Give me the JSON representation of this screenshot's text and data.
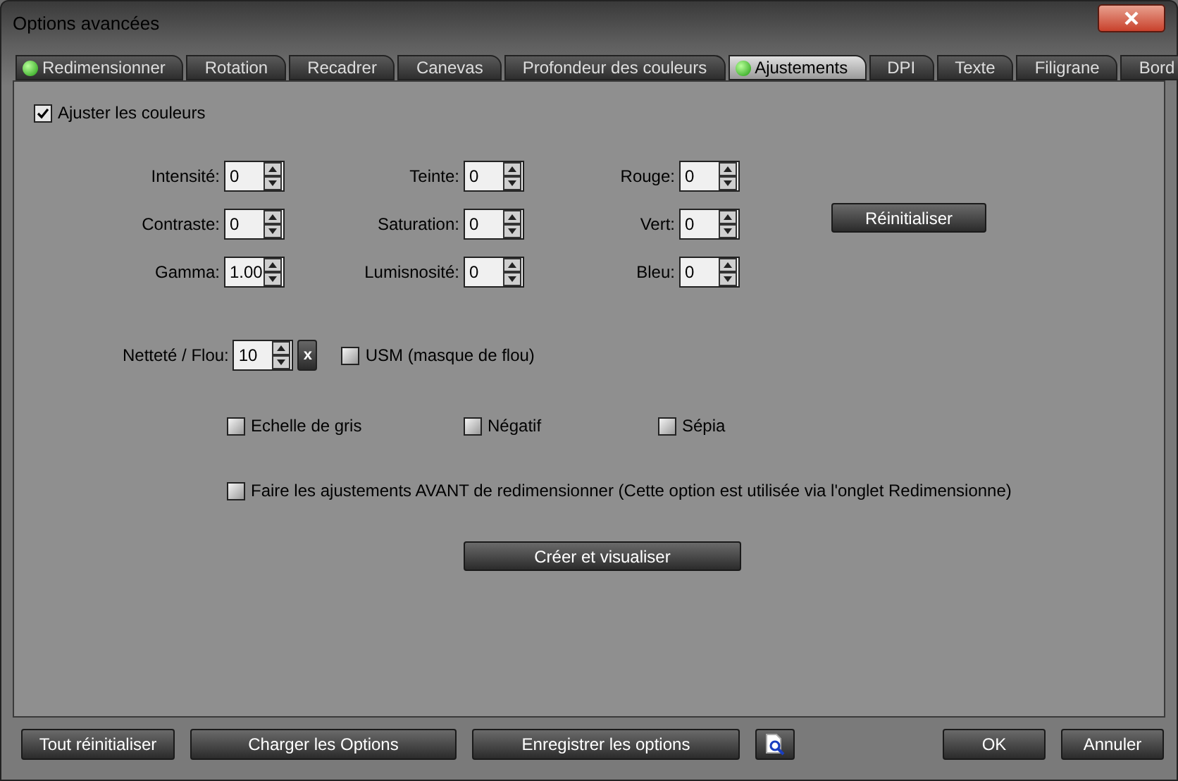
{
  "window": {
    "title": "Options avancées"
  },
  "tabs": [
    {
      "label": "Redimensionner",
      "selected": false,
      "indicator": true
    },
    {
      "label": "Rotation",
      "selected": false,
      "indicator": false
    },
    {
      "label": "Recadrer",
      "selected": false,
      "indicator": false
    },
    {
      "label": "Canevas",
      "selected": false,
      "indicator": false
    },
    {
      "label": "Profondeur des couleurs",
      "selected": false,
      "indicator": false
    },
    {
      "label": "Ajustements",
      "selected": true,
      "indicator": true
    },
    {
      "label": "DPI",
      "selected": false,
      "indicator": false
    },
    {
      "label": "Texte",
      "selected": false,
      "indicator": false
    },
    {
      "label": "Filigrane",
      "selected": false,
      "indicator": false
    },
    {
      "label": "Bord",
      "selected": false,
      "indicator": false
    }
  ],
  "adjust_colors": {
    "label": "Ajuster les couleurs",
    "checked": true
  },
  "spinners": [
    {
      "label": "Intensité:",
      "value": "0"
    },
    {
      "label": "Teinte:",
      "value": "0"
    },
    {
      "label": "Rouge:",
      "value": "0"
    },
    {
      "label": "Contraste:",
      "value": "0"
    },
    {
      "label": "Saturation:",
      "value": "0"
    },
    {
      "label": "Vert:",
      "value": "0"
    },
    {
      "label": "Gamma:",
      "value": "1.00"
    },
    {
      "label": "Lumisnosité:",
      "value": "0"
    },
    {
      "label": "Bleu:",
      "value": "0"
    }
  ],
  "reset_button": "Réinitialiser",
  "sharpness": {
    "label": "Netteté / Flou:",
    "value": "10",
    "clear_button": "x"
  },
  "usm": {
    "label": "USM (masque de flou)",
    "checked": false
  },
  "effects": [
    {
      "label": "Echelle de gris",
      "checked": false
    },
    {
      "label": "Négatif",
      "checked": false
    },
    {
      "label": "Sépia",
      "checked": false
    }
  ],
  "before_resize": {
    "label": "Faire les ajustements AVANT de redimensionner (Cette option est utilisée via l'onglet Redimensionne)",
    "checked": false
  },
  "preview_button": "Créer et visualiser",
  "footer": {
    "left": [
      "Tout réinitialiser",
      "Charger les Options",
      "Enregistrer les options"
    ],
    "right": [
      "OK",
      "Annuler"
    ]
  }
}
